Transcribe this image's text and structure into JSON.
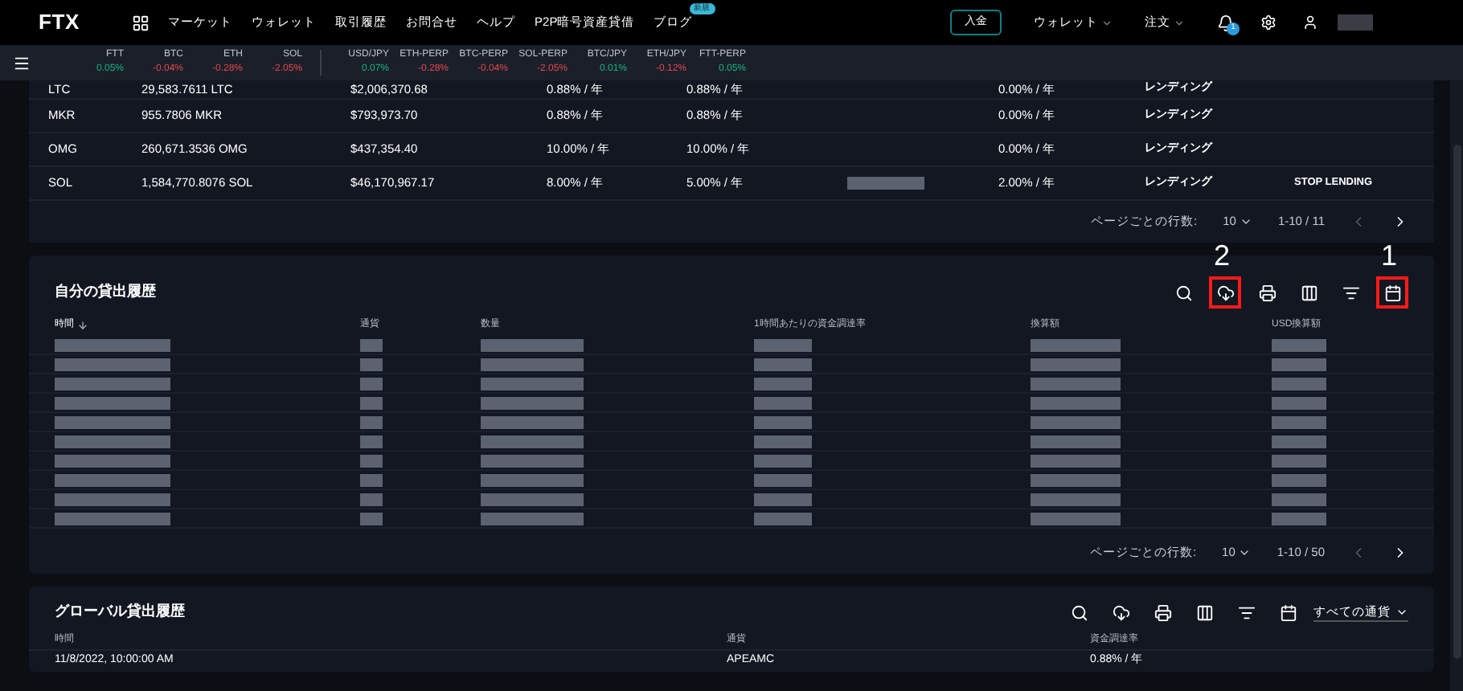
{
  "nav": {
    "logo": "FTX",
    "items": [
      "マーケット",
      "ウォレット",
      "取引履歴",
      "お問合せ",
      "ヘルプ",
      "P2P暗号資産貸借",
      "ブログ"
    ],
    "new_badge": "新規",
    "deposit": "入金",
    "menus": [
      "ウォレット",
      "注文"
    ],
    "notifications": "1"
  },
  "ticker": [
    {
      "name": "FTT",
      "change": "0.05%",
      "color": "#17b580"
    },
    {
      "name": "BTC",
      "change": "-0.04%",
      "color": "#e5484d"
    },
    {
      "name": "ETH",
      "change": "-0.28%",
      "color": "#e5484d"
    },
    {
      "name": "SOL",
      "change": "-2.05%",
      "color": "#e5484d"
    },
    {
      "name": "USD/JPY",
      "change": "0.07%",
      "color": "#17b580"
    },
    {
      "name": "ETH-PERP",
      "change": "-0.28%",
      "color": "#e5484d"
    },
    {
      "name": "BTC-PERP",
      "change": "-0.04%",
      "color": "#e5484d"
    },
    {
      "name": "SOL-PERP",
      "change": "-2.05%",
      "color": "#e5484d"
    },
    {
      "name": "BTC/JPY",
      "change": "0.01%",
      "color": "#17b580"
    },
    {
      "name": "ETH/JPY",
      "change": "-0.12%",
      "color": "#e5484d"
    },
    {
      "name": "FTT-PERP",
      "change": "0.05%",
      "color": "#17b580"
    }
  ],
  "lending_table": {
    "rows": [
      {
        "coin": "LTC",
        "amount": "29,583.7611 LTC",
        "value": "$2,006,370.68",
        "rate_1": "0.88% / 年",
        "rate_2": "0.88% / 年",
        "redacted": false,
        "rate_3": "0.00% / 年",
        "status": "レンディング"
      },
      {
        "coin": "MKR",
        "amount": "955.7806 MKR",
        "value": "$793,973.70",
        "rate_1": "0.88% / 年",
        "rate_2": "0.88% / 年",
        "redacted": false,
        "rate_3": "0.00% / 年",
        "status": "レンディング"
      },
      {
        "coin": "OMG",
        "amount": "260,671.3536 OMG",
        "value": "$437,354.40",
        "rate_1": "10.00% / 年",
        "rate_2": "10.00% / 年",
        "redacted": false,
        "rate_3": "0.00% / 年",
        "status": "レンディング"
      },
      {
        "coin": "SOL",
        "amount": "1,584,770.8076 SOL",
        "value": "$46,170,967.17",
        "rate_1": "8.00% / 年",
        "rate_2": "5.00% / 年",
        "redacted": true,
        "rate_3": "2.00% / 年",
        "status": "レンディング",
        "action": "STOP LENDING"
      }
    ],
    "pagination": {
      "label": "ページごとの行数:",
      "per_page": "10",
      "range": "1-10 / 11"
    }
  },
  "my_history": {
    "title": "自分の貸出履歴",
    "toolbar": [
      {
        "kind": "search"
      },
      {
        "kind": "download",
        "callout": "2"
      },
      {
        "kind": "print"
      },
      {
        "kind": "columns"
      },
      {
        "kind": "filter"
      },
      {
        "kind": "calendar",
        "callout": "1"
      }
    ],
    "columns": [
      {
        "label": "時間",
        "sorted": true
      },
      {
        "label": "通貨",
        "sorted": false
      },
      {
        "label": "数量",
        "sorted": false
      },
      {
        "label": "1時間あたりの資金調達率",
        "sorted": false
      },
      {
        "label": "換算額",
        "sorted": false
      },
      {
        "label": "USD換算額",
        "sorted": false
      }
    ],
    "rows": [
      {
        "redacted": true
      },
      {
        "redacted": true
      },
      {
        "redacted": true
      },
      {
        "redacted": true
      },
      {
        "redacted": true
      },
      {
        "redacted": true
      },
      {
        "redacted": true
      },
      {
        "redacted": true
      },
      {
        "redacted": true
      },
      {
        "redacted": true
      }
    ],
    "pagination": {
      "label": "ページごとの行数:",
      "per_page": "10",
      "range": "1-10 / 50"
    }
  },
  "global_history": {
    "title": "グローバル貸出履歴",
    "toolbar": [
      {
        "kind": "search"
      },
      {
        "kind": "download"
      },
      {
        "kind": "print"
      },
      {
        "kind": "columns"
      },
      {
        "kind": "filter"
      },
      {
        "kind": "calendar"
      }
    ],
    "currency_filter": "すべての通貨",
    "columns": [
      "時間",
      "通貨",
      "資金調達率"
    ],
    "rows": [
      [
        "11/8/2022, 10:00:00 AM",
        "APEAMC",
        "0.88% / 年"
      ]
    ]
  }
}
